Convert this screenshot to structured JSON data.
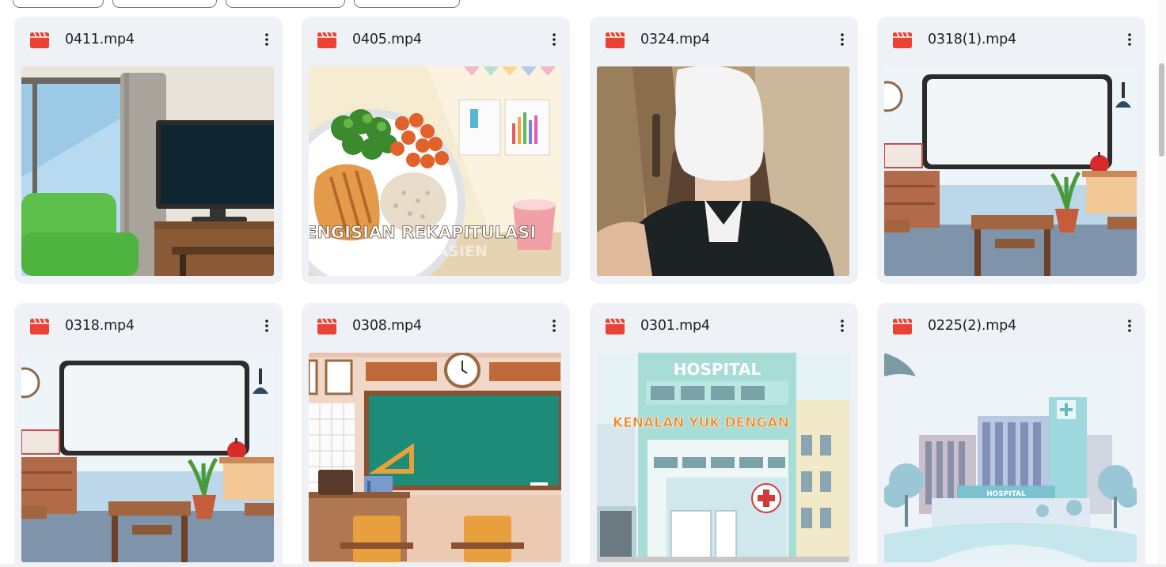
{
  "filters": [
    "",
    "",
    "",
    ""
  ],
  "files": [
    {
      "name": "0411.mp4",
      "icon": "video-file-icon",
      "thumb": "living-room-tv"
    },
    {
      "name": "0405.mp4",
      "icon": "video-file-icon",
      "thumb": "meal-plate",
      "overlay_line1": "ENGISIAN REKAPITULASI",
      "overlay_line2": "AN MAKANAN PASIEN"
    },
    {
      "name": "0324.mp4",
      "icon": "video-file-icon",
      "thumb": "selfie-person"
    },
    {
      "name": "0318(1).mp4",
      "icon": "video-file-icon",
      "thumb": "classroom-whiteboard"
    },
    {
      "name": "0318.mp4",
      "icon": "video-file-icon",
      "thumb": "classroom-whiteboard"
    },
    {
      "name": "0308.mp4",
      "icon": "video-file-icon",
      "thumb": "classroom-chalkboard"
    },
    {
      "name": "0301.mp4",
      "icon": "video-file-icon",
      "thumb": "hospital-front",
      "overlay_sign": "HOSPITAL",
      "overlay_banner": "KENALAN YUK DENGAN"
    },
    {
      "name": "0225(2).mp4",
      "icon": "video-file-icon",
      "thumb": "hospital-skyline",
      "overlay_sign": "HOSPITAL"
    }
  ],
  "menu_icon": "more-vert-icon",
  "colors": {
    "card_bg": "#eef1f6",
    "video_red": "#ea4335",
    "text": "#1f1f1f"
  }
}
